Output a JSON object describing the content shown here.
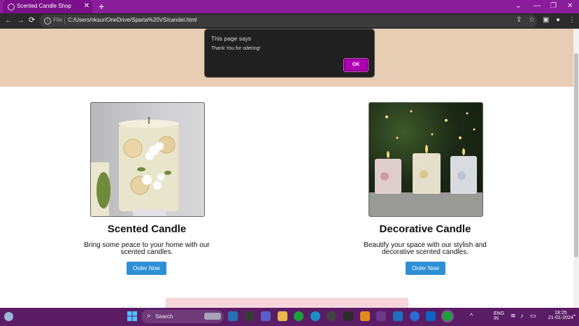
{
  "browser": {
    "tab_title": "Scented Candle Shop",
    "tab_close": "✕",
    "new_tab": "+",
    "window_controls": [
      "⌄",
      "—",
      "❐",
      "✕"
    ],
    "nav": [
      "←",
      "→",
      "⟳"
    ],
    "address_scheme": "File",
    "address_url": "C:/Users/nksur/OneDrive/Sparta%20VS/candel.html",
    "toolbar_icons": [
      "⇪",
      "☆",
      "▣",
      "●",
      "⋮"
    ]
  },
  "dialog": {
    "title": "This page says",
    "message": "Thank You for odering!",
    "ok_label": "OK"
  },
  "products": [
    {
      "title": "Scented Candle",
      "desc_line1": "Bring some peace to your home with our",
      "desc_line2": "scented candles.",
      "button": "Order Now"
    },
    {
      "title": "Decorative Candle",
      "desc_line1": "Beautify your space with our stylish and",
      "desc_line2": "decorative scented candles.",
      "button": "Order Now"
    }
  ],
  "taskbar": {
    "search_label": "Search",
    "lang": "ENG",
    "region": "IN",
    "time": "18:25",
    "date": "21-01-2024"
  },
  "colors": {
    "tab_bar": "#8a1e9a",
    "hero": "#e8cdb5",
    "button": "#2e8fd5",
    "dialog_ok": "#b000b4",
    "taskbar": "#5b1c66"
  }
}
